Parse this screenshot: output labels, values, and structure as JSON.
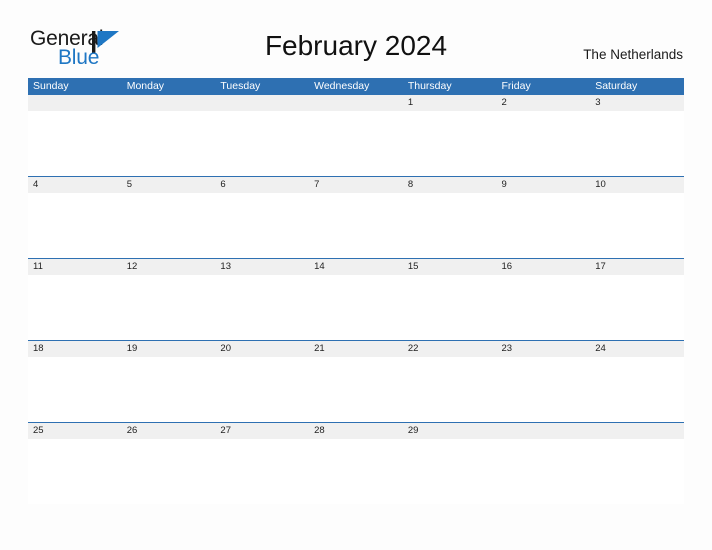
{
  "brand": {
    "name_part1": "General",
    "name_part2": "Blue",
    "triangle_color": "#1f77c4",
    "text_color": "#1a1a1a"
  },
  "header": {
    "title": "February 2024",
    "subtitle": "The Netherlands"
  },
  "theme": {
    "header_blue": "#2E70B2",
    "date_band_gray": "#f0f0f0",
    "rule_blue": "#2E70B2",
    "page_background": "#fdfdfd"
  },
  "calendar": {
    "month": "February",
    "year": "2024",
    "weekday_headers": [
      "Sunday",
      "Monday",
      "Tuesday",
      "Wednesday",
      "Thursday",
      "Friday",
      "Saturday"
    ],
    "weeks": [
      {
        "ruled": false,
        "days": [
          {
            "date": "",
            "empty": true
          },
          {
            "date": "",
            "empty": true
          },
          {
            "date": "",
            "empty": true
          },
          {
            "date": "",
            "empty": true
          },
          {
            "date": "1",
            "empty": false
          },
          {
            "date": "2",
            "empty": false
          },
          {
            "date": "3",
            "empty": false
          }
        ]
      },
      {
        "ruled": true,
        "days": [
          {
            "date": "4",
            "empty": false
          },
          {
            "date": "5",
            "empty": false
          },
          {
            "date": "6",
            "empty": false
          },
          {
            "date": "7",
            "empty": false
          },
          {
            "date": "8",
            "empty": false
          },
          {
            "date": "9",
            "empty": false
          },
          {
            "date": "10",
            "empty": false
          }
        ]
      },
      {
        "ruled": true,
        "days": [
          {
            "date": "11",
            "empty": false
          },
          {
            "date": "12",
            "empty": false
          },
          {
            "date": "13",
            "empty": false
          },
          {
            "date": "14",
            "empty": false
          },
          {
            "date": "15",
            "empty": false
          },
          {
            "date": "16",
            "empty": false
          },
          {
            "date": "17",
            "empty": false
          }
        ]
      },
      {
        "ruled": true,
        "days": [
          {
            "date": "18",
            "empty": false
          },
          {
            "date": "19",
            "empty": false
          },
          {
            "date": "20",
            "empty": false
          },
          {
            "date": "21",
            "empty": false
          },
          {
            "date": "22",
            "empty": false
          },
          {
            "date": "23",
            "empty": false
          },
          {
            "date": "24",
            "empty": false
          }
        ]
      },
      {
        "ruled": true,
        "days": [
          {
            "date": "25",
            "empty": false
          },
          {
            "date": "26",
            "empty": false
          },
          {
            "date": "27",
            "empty": false
          },
          {
            "date": "28",
            "empty": false
          },
          {
            "date": "29",
            "empty": false
          },
          {
            "date": "",
            "empty": true
          },
          {
            "date": "",
            "empty": true
          }
        ]
      }
    ]
  }
}
